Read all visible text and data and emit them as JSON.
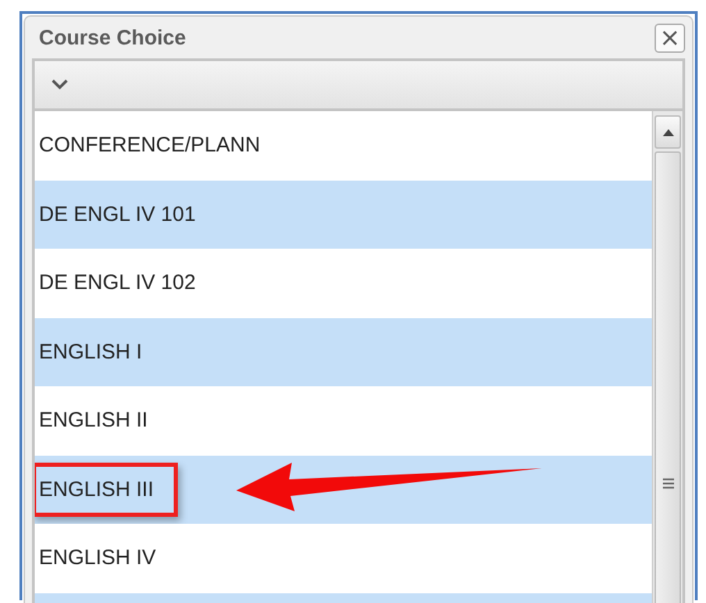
{
  "dialog": {
    "title": "Course Choice",
    "close": "×"
  },
  "courses": [
    {
      "label": "CONFERENCE/PLANN",
      "annotated": false
    },
    {
      "label": "DE ENGL IV 101",
      "annotated": false
    },
    {
      "label": "DE ENGL IV 102",
      "annotated": false
    },
    {
      "label": "ENGLISH I",
      "annotated": false
    },
    {
      "label": "ENGLISH II",
      "annotated": false
    },
    {
      "label": "ENGLISH III",
      "annotated": true
    },
    {
      "label": "ENGLISH IV",
      "annotated": false
    }
  ]
}
